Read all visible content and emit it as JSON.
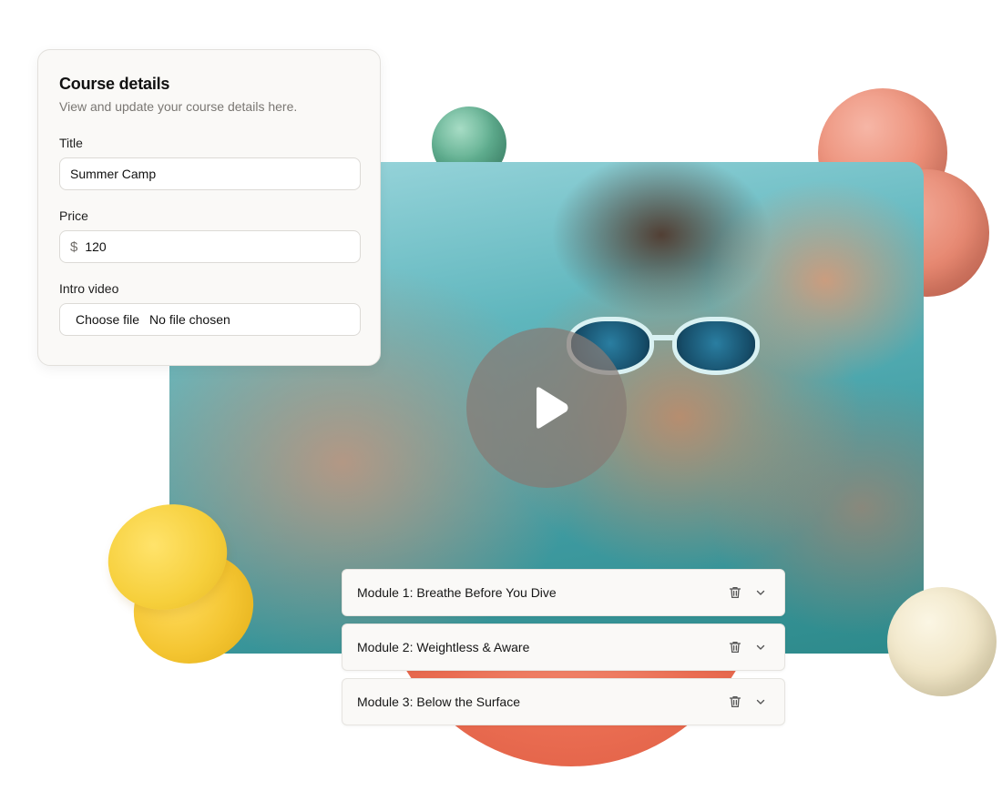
{
  "course_details": {
    "title": "Course details",
    "subtitle": "View and update your course details here.",
    "fields": {
      "title_label": "Title",
      "title_value": "Summer Camp",
      "price_label": "Price",
      "price_currency": "$",
      "price_value": "120",
      "video_label": "Intro video",
      "video_button": "Choose file",
      "video_status": "No file chosen"
    }
  },
  "video": {
    "play_icon": "play-icon"
  },
  "modules": [
    {
      "label": "Module 1: Breathe Before You Dive",
      "delete_icon": "trash-icon",
      "expand_icon": "chevron-down-icon"
    },
    {
      "label": "Module 2: Weightless & Aware",
      "delete_icon": "trash-icon",
      "expand_icon": "chevron-down-icon"
    },
    {
      "label": "Module 3: Below the Surface",
      "delete_icon": "trash-icon",
      "expand_icon": "chevron-down-icon"
    }
  ],
  "colors": {
    "panel_bg": "#faf9f7",
    "accent_salmon": "#ec8f78",
    "accent_green": "#5fae8f",
    "accent_yellow": "#f4c531",
    "accent_cream": "#efe4c4"
  }
}
